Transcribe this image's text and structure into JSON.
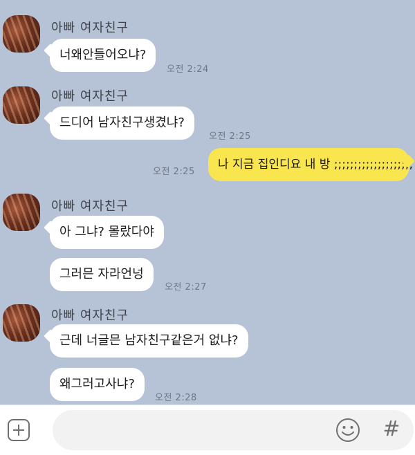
{
  "messages": [
    {
      "sender": "아빠 여자친구",
      "bubbles": [
        "너왜안들어오냐?"
      ],
      "time": "오전 2:24"
    },
    {
      "sender": "아빠 여자친구",
      "bubbles": [
        "드디어 남자친구생겼냐?"
      ],
      "time": "오전 2:25"
    },
    {
      "mine": true,
      "text": "나 지금 집인디요 내 방 ;;;;;;;;;;;;;;;;;;;;",
      "time": "오전 2:25"
    },
    {
      "sender": "아빠 여자친구",
      "bubbles": [
        "아 그냐? 몰랐다야",
        "그러믄 자라언넝"
      ],
      "time": "오전 2:27"
    },
    {
      "sender": "아빠 여자친구",
      "bubbles": [
        "근데 너글믄 남자친구같은거 없냐?",
        "왜그러고사냐?"
      ],
      "time": "오전 2:28"
    }
  ],
  "input_bar": {
    "placeholder": "",
    "plus_icon": "plus-square-icon",
    "emoji_icon": "smiley-icon",
    "hash_label": "#"
  },
  "colors": {
    "chat_background": "#b6c3d6",
    "my_bubble": "#f9e64f",
    "other_bubble": "#ffffff"
  }
}
